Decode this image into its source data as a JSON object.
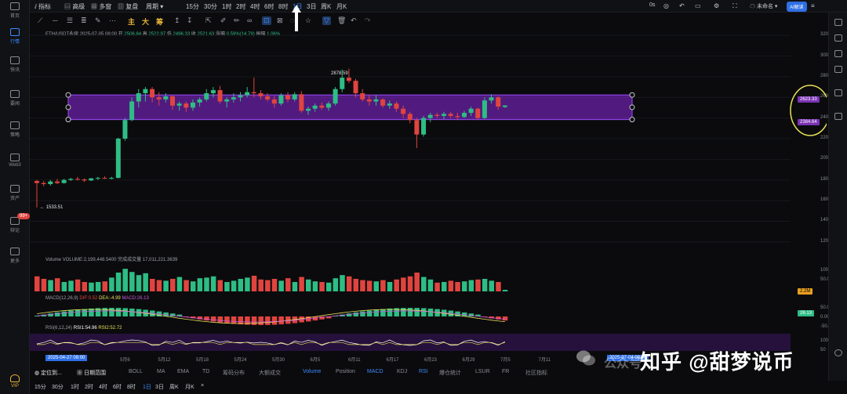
{
  "sidebar": {
    "items": [
      {
        "label": "首页",
        "icon": "home-icon"
      },
      {
        "label": "行情",
        "icon": "market-icon"
      },
      {
        "label": "快讯",
        "icon": "news-icon"
      },
      {
        "label": "要闻",
        "icon": "headline-icon"
      },
      {
        "label": "策略",
        "icon": "strategy-icon"
      },
      {
        "label": "Web3",
        "icon": "web3-icon"
      },
      {
        "label": "资产",
        "icon": "asset-icon"
      },
      {
        "label": "辩论",
        "icon": "debate-icon"
      },
      {
        "label": "更多",
        "icon": "more-icon"
      },
      {
        "label": "VIP",
        "icon": "vip-icon"
      }
    ],
    "badge": "99+"
  },
  "topbar": {
    "items": [
      "指标",
      "高级",
      "多窗",
      "复盘",
      "周期",
      "15分",
      "30分",
      "1时",
      "2时",
      "4时",
      "6时",
      "8时",
      "1日",
      "3日",
      "周K",
      "月K"
    ],
    "active": "1日",
    "right_time": "0s",
    "account": "未命名",
    "ai_label": "AI解读"
  },
  "drawbar": {
    "tools": [
      "主",
      "大",
      "筹"
    ]
  },
  "legend": {
    "symbol": "ETH/USDT永续",
    "datetime": "2025-07-05 08:00",
    "open_label": "开",
    "open": "2506.84",
    "high_label": "高",
    "high": "2522.97",
    "low_label": "低",
    "low": "2496.33",
    "close_label": "收",
    "close": "2521.63",
    "change_label": "涨幅",
    "change": "0.59%(14.79)",
    "amp_label": "振幅",
    "amp": "1.06%"
  },
  "annotations": {
    "high_label": "2878.59",
    "low_label": "1533.51",
    "band_top": "2623.33",
    "band_bottom": "2384.64"
  },
  "y_axis": [
    "3200.00",
    "3000.00",
    "2800.00",
    "2600.00",
    "2400.00",
    "2200.00",
    "2000.00",
    "1800.00",
    "1600.00",
    "1400.00",
    "1200.00"
  ],
  "volume": {
    "title": "Volume",
    "label": "VOLUME",
    "value": "2,199,448.5400",
    "extra_label": "完成成交量",
    "extra_value": "17,011,221.3639",
    "y_axis": [
      "100.00M",
      "50.00M"
    ],
    "tag": "2.2M"
  },
  "macd": {
    "title": "MACD(12,26,9)",
    "dif_label": "DIF",
    "dif": "0.52",
    "dea_label": "DEA",
    "dea": "-4.99",
    "macd_label": "MACD",
    "macd": "26.13",
    "y_axis": [
      "50.00",
      "0.00",
      "-50.00"
    ],
    "tag": "26.13"
  },
  "rsi": {
    "title": "RSI(6,12,24)",
    "rsi1": "RSI1:54.96",
    "rsi2": "RSI2:52.72",
    "y_axis": [
      "100",
      "50"
    ]
  },
  "timeaxis": {
    "start_badge": "2025-04-27 08:00",
    "end_badge": "2025-07-04 08:00",
    "labels": [
      "5月6",
      "5月12",
      "5月18",
      "5月24",
      "5月30",
      "6月5",
      "6月11",
      "6月17",
      "6月23",
      "6月29",
      "7月5",
      "7月11"
    ]
  },
  "indicator_bar": {
    "left": [
      "定位到...",
      "日期范围"
    ],
    "items": [
      "BOLL",
      "MA",
      "EMA",
      "TD",
      "筹码分布",
      "大额成交",
      "Volume",
      "Position",
      "MACD",
      "KDJ",
      "RSI",
      "爆仓统计",
      "LSUR",
      "FR",
      "社区指标"
    ],
    "active": [
      "Volume",
      "MACD",
      "RSI"
    ]
  },
  "interval_bar": {
    "items": [
      "15分",
      "30分",
      "1时",
      "2时",
      "4时",
      "6时",
      "8时",
      "1日",
      "3日",
      "周K",
      "月K"
    ],
    "active": "1日",
    "close": "×"
  },
  "watermark": {
    "gongzhonghao": "公众号",
    "text": "知乎 @甜梦说币"
  },
  "chart_data": {
    "type": "candlestick",
    "x": [
      "04-27",
      "04-28",
      "04-29",
      "04-30",
      "05-01",
      "05-02",
      "05-03",
      "05-04",
      "05-05",
      "05-06",
      "05-07",
      "05-08",
      "05-09",
      "05-10",
      "05-11",
      "05-12",
      "05-13",
      "05-14",
      "05-15",
      "05-16",
      "05-17",
      "05-18",
      "05-19",
      "05-20",
      "05-21",
      "05-22",
      "05-23",
      "05-24",
      "05-25",
      "05-26",
      "05-27",
      "05-28",
      "05-29",
      "05-30",
      "05-31",
      "06-01",
      "06-02",
      "06-03",
      "06-04",
      "06-05",
      "06-06",
      "06-07",
      "06-08",
      "06-09",
      "06-10",
      "06-11",
      "06-12",
      "06-13",
      "06-14",
      "06-15",
      "06-16",
      "06-17",
      "06-18",
      "06-19",
      "06-20",
      "06-21",
      "06-22",
      "06-23",
      "06-24",
      "06-25",
      "06-26",
      "06-27",
      "06-28",
      "06-29",
      "06-30",
      "07-01",
      "07-02",
      "07-03",
      "07-04",
      "07-05"
    ],
    "ohlc": [
      [
        1790,
        1800,
        1533,
        1770
      ],
      [
        1770,
        1790,
        1740,
        1760
      ],
      [
        1760,
        1800,
        1745,
        1785
      ],
      [
        1785,
        1810,
        1760,
        1770
      ],
      [
        1770,
        1810,
        1765,
        1800
      ],
      [
        1800,
        1820,
        1790,
        1810
      ],
      [
        1810,
        1830,
        1795,
        1805
      ],
      [
        1805,
        1815,
        1780,
        1795
      ],
      [
        1795,
        1820,
        1790,
        1815
      ],
      [
        1815,
        1830,
        1800,
        1820
      ],
      [
        1820,
        1835,
        1810,
        1815
      ],
      [
        1815,
        1830,
        1805,
        1820
      ],
      [
        1820,
        2210,
        1815,
        2200
      ],
      [
        2200,
        2400,
        2180,
        2380
      ],
      [
        2380,
        2600,
        2370,
        2560
      ],
      [
        2560,
        2680,
        2500,
        2640
      ],
      [
        2640,
        2700,
        2560,
        2680
      ],
      [
        2680,
        2700,
        2550,
        2600
      ],
      [
        2600,
        2650,
        2520,
        2580
      ],
      [
        2580,
        2640,
        2550,
        2610
      ],
      [
        2610,
        2620,
        2480,
        2520
      ],
      [
        2520,
        2560,
        2470,
        2540
      ],
      [
        2540,
        2560,
        2460,
        2500
      ],
      [
        2500,
        2580,
        2470,
        2550
      ],
      [
        2550,
        2600,
        2510,
        2580
      ],
      [
        2580,
        2680,
        2560,
        2640
      ],
      [
        2640,
        2700,
        2600,
        2670
      ],
      [
        2670,
        2710,
        2540,
        2560
      ],
      [
        2560,
        2600,
        2500,
        2580
      ],
      [
        2580,
        2640,
        2550,
        2600
      ],
      [
        2600,
        2650,
        2560,
        2620
      ],
      [
        2620,
        2700,
        2600,
        2650
      ],
      [
        2650,
        2790,
        2600,
        2640
      ],
      [
        2640,
        2670,
        2580,
        2610
      ],
      [
        2610,
        2640,
        2560,
        2580
      ],
      [
        2580,
        2610,
        2500,
        2540
      ],
      [
        2540,
        2640,
        2520,
        2620
      ],
      [
        2620,
        2650,
        2550,
        2580
      ],
      [
        2580,
        2650,
        2560,
        2630
      ],
      [
        2630,
        2660,
        2450,
        2470
      ],
      [
        2470,
        2510,
        2430,
        2490
      ],
      [
        2490,
        2540,
        2460,
        2520
      ],
      [
        2520,
        2550,
        2480,
        2500
      ],
      [
        2500,
        2560,
        2470,
        2540
      ],
      [
        2540,
        2700,
        2520,
        2680
      ],
      [
        2680,
        2870,
        2650,
        2790
      ],
      [
        2790,
        2878,
        2740,
        2760
      ],
      [
        2760,
        2780,
        2600,
        2640
      ],
      [
        2640,
        2680,
        2560,
        2580
      ],
      [
        2580,
        2620,
        2520,
        2560
      ],
      [
        2560,
        2620,
        2520,
        2580
      ],
      [
        2580,
        2590,
        2500,
        2520
      ],
      [
        2520,
        2570,
        2490,
        2540
      ],
      [
        2540,
        2560,
        2460,
        2490
      ],
      [
        2490,
        2520,
        2400,
        2440
      ],
      [
        2440,
        2460,
        2350,
        2380
      ],
      [
        2380,
        2400,
        2110,
        2240
      ],
      [
        2240,
        2420,
        2220,
        2400
      ],
      [
        2400,
        2450,
        2360,
        2430
      ],
      [
        2430,
        2450,
        2400,
        2420
      ],
      [
        2420,
        2460,
        2390,
        2440
      ],
      [
        2440,
        2460,
        2400,
        2420
      ],
      [
        2420,
        2450,
        2380,
        2410
      ],
      [
        2410,
        2470,
        2400,
        2450
      ],
      [
        2450,
        2510,
        2420,
        2490
      ],
      [
        2490,
        2500,
        2380,
        2400
      ],
      [
        2400,
        2600,
        2390,
        2570
      ],
      [
        2570,
        2630,
        2540,
        2600
      ],
      [
        2600,
        2610,
        2480,
        2510
      ],
      [
        2506.84,
        2522.97,
        2496.33,
        2521.63
      ]
    ],
    "y_range": [
      1100,
      3300
    ],
    "volume_m": [
      48,
      40,
      36,
      42,
      30,
      34,
      38,
      30,
      28,
      30,
      32,
      44,
      60,
      72,
      62,
      52,
      58,
      40,
      36,
      34,
      40,
      46,
      36,
      32,
      42,
      44,
      48,
      36,
      30,
      34,
      40,
      44,
      50,
      38,
      36,
      40,
      34,
      42,
      30,
      46,
      38,
      32,
      30,
      28,
      42,
      52,
      48,
      40,
      36,
      34,
      32,
      36,
      30,
      38,
      44,
      48,
      60,
      46,
      38,
      28,
      30,
      34,
      30,
      32,
      36,
      38,
      40,
      34,
      30,
      5
    ],
    "y_label_unit": "M"
  }
}
